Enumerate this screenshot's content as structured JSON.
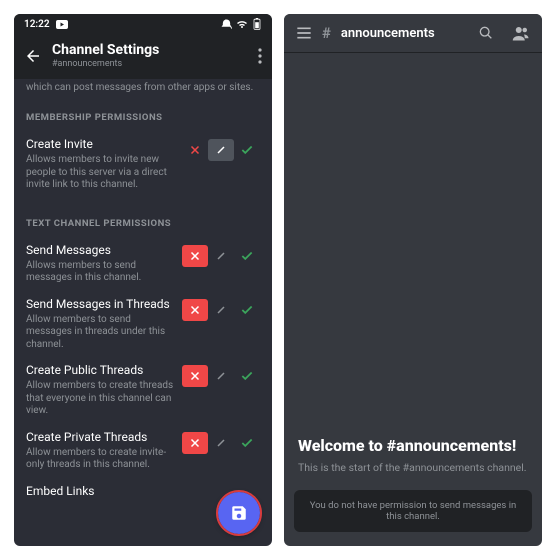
{
  "statusbar": {
    "time": "12:22"
  },
  "left": {
    "header": {
      "title": "Channel Settings",
      "subtitle": "#announcements"
    },
    "truncated_lead": "which can post messages from other apps or sites.",
    "sections": {
      "membership": {
        "heading": "MEMBERSHIP PERMISSIONS",
        "rows": [
          {
            "title": "Create Invite",
            "desc": "Allows members to invite new people to this server via a direct invite link to this channel.",
            "state": "neutral"
          }
        ]
      },
      "text": {
        "heading": "TEXT CHANNEL PERMISSIONS",
        "rows": [
          {
            "title": "Send Messages",
            "desc": "Allows members to send messages in this channel.",
            "state": "deny"
          },
          {
            "title": "Send Messages in Threads",
            "desc": "Allow members to send messages in threads under this channel.",
            "state": "deny"
          },
          {
            "title": "Create Public Threads",
            "desc": "Allow members to create threads that everyone in this channel can view.",
            "state": "deny"
          },
          {
            "title": "Create Private Threads",
            "desc": "Allow members to create invite-only threads in this channel.",
            "state": "deny"
          },
          {
            "title": "Embed Links",
            "desc": "",
            "state": "deny"
          }
        ]
      }
    }
  },
  "right": {
    "channel_name": "announcements",
    "welcome_title": "Welcome to #announcements!",
    "welcome_sub": "This is the start of the #announcements channel.",
    "lock_msg": "You do not have permission to send messages in this channel."
  }
}
